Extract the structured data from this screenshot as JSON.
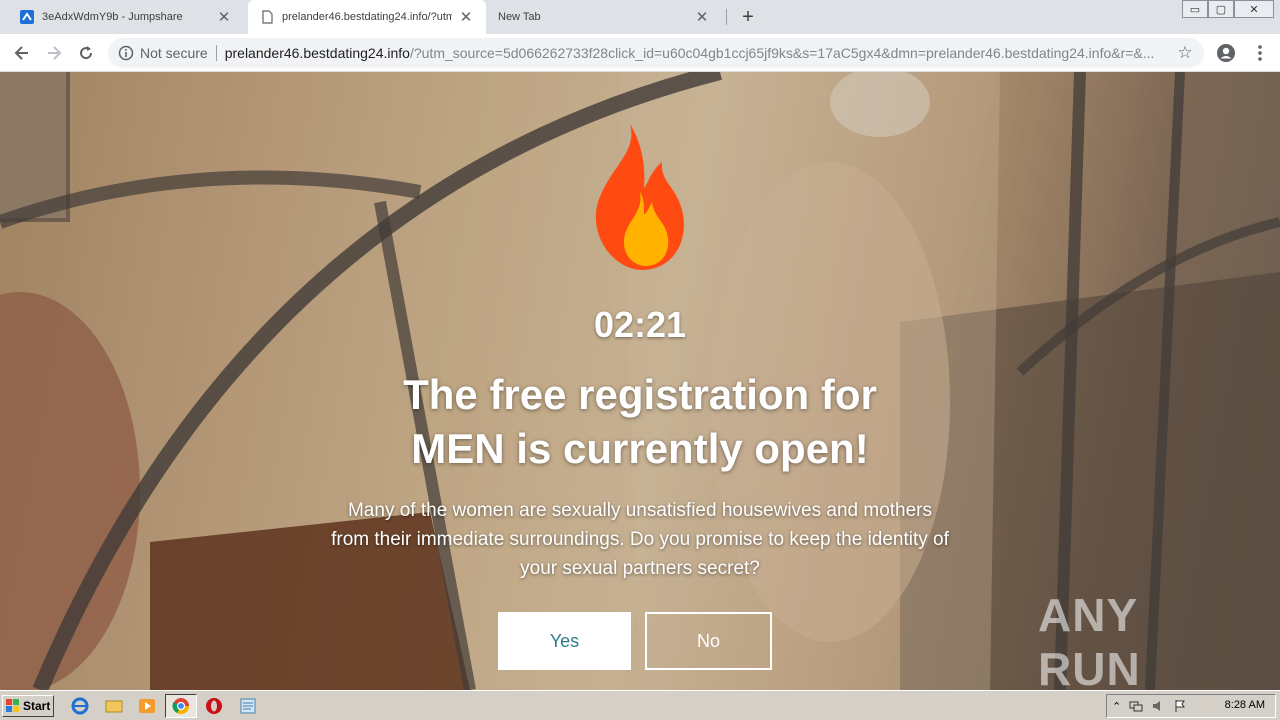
{
  "tabs": [
    {
      "title": "3eAdxWdmY9b - Jumpshare",
      "close": "✕"
    },
    {
      "title": "prelander46.bestdating24.info/?utm",
      "close": "✕"
    },
    {
      "title": "New Tab",
      "close": "✕"
    }
  ],
  "new_tab_label": "+",
  "window_controls": {
    "minimize": "▭",
    "restore": "▢",
    "close": "✕"
  },
  "omnibox": {
    "security_label": "Not secure",
    "url_host": "prelander46.bestdating24.info",
    "url_rest": "/?utm_source=5d066262733f28click_id=u60c04gb1ccj65jf9ks&s=17aC5gx4&dmn=prelander46.bestdating24.info&r=&..."
  },
  "page": {
    "timer": "02:21",
    "headline_line1": "The free registration for",
    "headline_line2": "MEN is currently open!",
    "body": "Many of the women are sexually unsatisfied housewives and mothers from their immediate surroundings. Do you promise to keep the identity of your sexual partners secret?",
    "yes_label": "Yes",
    "no_label": "No",
    "watermark": "ANY RUN"
  },
  "taskbar": {
    "start_label": "Start",
    "clock": "8:28 AM"
  },
  "colors": {
    "yes_text": "#2f7a8c",
    "flame_outer": "#ff4a12",
    "flame_inner": "#ffb300"
  }
}
